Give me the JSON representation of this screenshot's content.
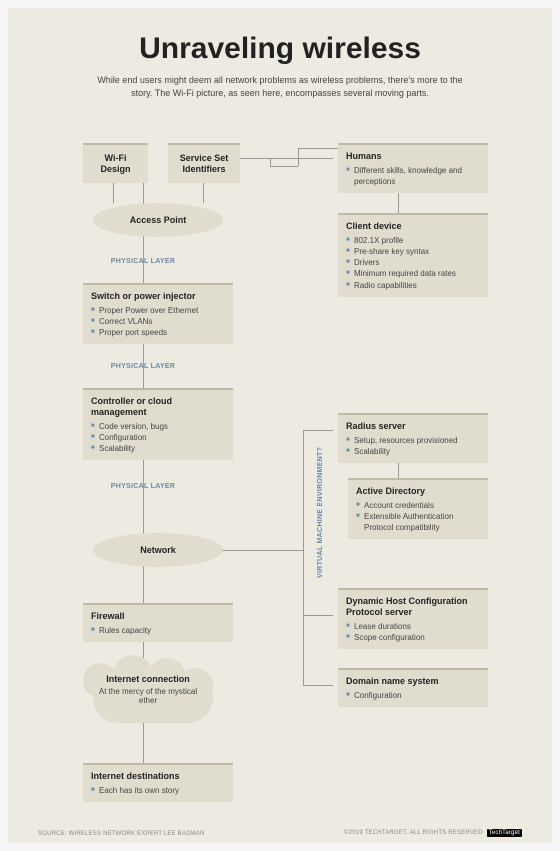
{
  "header": {
    "title": "Unraveling wireless",
    "subtitle": "While end users might deem all network problems as wireless problems, there's more to the story. The Wi-Fi picture, as seen here, encompasses several moving parts."
  },
  "small": {
    "wifi": "Wi-Fi Design",
    "ssid": "Service Set Identifiers"
  },
  "ellipse": {
    "ap": "Access Point",
    "network": "Network"
  },
  "label": {
    "phys1": "PHYSICAL LAYER",
    "phys2": "PHYSICAL LAYER",
    "phys3": "PHYSICAL LAYER",
    "vme": "VIRTUAL MACHINE ENVIRONMENT?"
  },
  "humans": {
    "title": "Humans",
    "items": [
      "Different skills, knowledge and perceptions"
    ]
  },
  "client": {
    "title": "Client device",
    "items": [
      "802.1X profile",
      "Pre-share key syntax",
      "Drivers",
      "Minimum required data rates",
      "Radio capabilities"
    ]
  },
  "switch": {
    "title": "Switch or power injector",
    "items": [
      "Proper Power over Ethernet",
      "Correct VLANs",
      "Proper port speeds"
    ]
  },
  "controller": {
    "title": "Controller or cloud management",
    "items": [
      "Code version, bugs",
      "Configuration",
      "Scalability"
    ]
  },
  "radius": {
    "title": "Radius server",
    "items": [
      "Setup, resources provisioned",
      "Scalability"
    ]
  },
  "ad": {
    "title": "Active Directory",
    "items": [
      "Account credentials",
      "Extensible Authentication Protocol compatibility"
    ]
  },
  "dhcp": {
    "title": "Dynamic Host Configuration Protocol server",
    "items": [
      "Lease durations",
      "Scope configuration"
    ]
  },
  "dns": {
    "title": "Domain name system",
    "items": [
      "Configuration"
    ]
  },
  "firewall": {
    "title": "Firewall",
    "items": [
      "Rules capacity"
    ]
  },
  "internet": {
    "title": "Internet connection",
    "sub": "At the mercy of the mystical ether"
  },
  "dest": {
    "title": "Internet destinations",
    "items": [
      "Each has its own story"
    ]
  },
  "footer": {
    "source": "SOURCE: WIRELESS NETWORK EXPERT LEE BADMAN",
    "copyright": "©2019 TECHTARGET. ALL RIGHTS RESERVED",
    "logo": "TechTarget"
  }
}
